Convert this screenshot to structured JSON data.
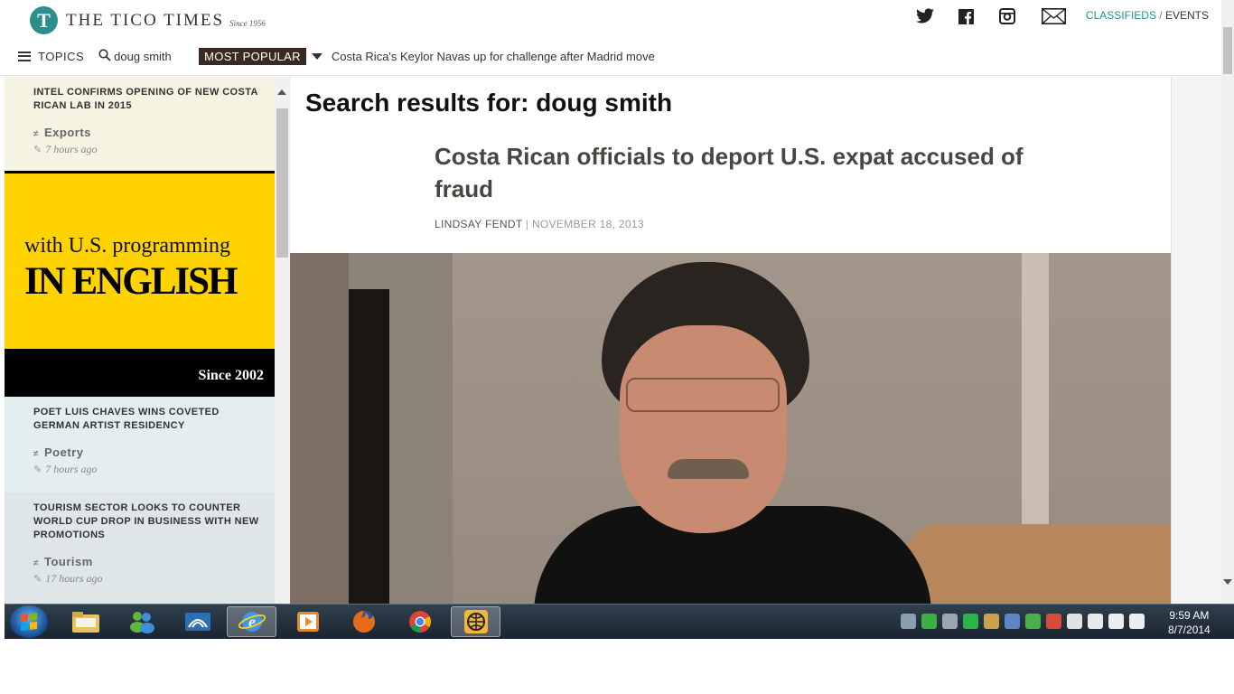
{
  "header": {
    "logo_letter": "T",
    "logo_name": "THE TICO TIMES",
    "logo_since": "Since 1956",
    "classifieds": "CLASSIFIEDS",
    "separator": "/",
    "events": "EVENTS"
  },
  "nav": {
    "topics": "TOPICS",
    "search_value": "doug smith",
    "most_popular": "MOST POPULAR",
    "ticker_headline": "Costa Rica's Keylor Navas up for challenge after Madrid move"
  },
  "sidebar": {
    "items": [
      {
        "title": "INTEL CONFIRMS OPENING OF NEW COSTA RICAN LAB IN 2015",
        "category": "Exports",
        "time": "7 hours ago"
      },
      {
        "title": "POET LUIS CHAVES WINS COVETED GERMAN ARTIST RESIDENCY",
        "category": "Poetry",
        "time": "7 hours ago"
      },
      {
        "title": "TOURISM SECTOR LOOKS TO COUNTER WORLD CUP DROP IN BUSINESS WITH NEW PROMOTIONS",
        "category": "Tourism",
        "time": "17 hours ago"
      }
    ],
    "ad": {
      "line1": "with U.S. programming",
      "line2": "IN ENGLISH",
      "since": "Since 2002"
    }
  },
  "main": {
    "search_heading": "Search results for: doug smith",
    "article_title": "Costa Rican officials to deport U.S. expat accused of fraud",
    "author": "LINDSAY FENDT",
    "byline_sep": "|",
    "date": "NOVEMBER 18, 2013"
  },
  "taskbar": {
    "time": "9:59 AM",
    "date": "8/7/2014"
  },
  "colors": {
    "brand_teal": "#2b8f8c",
    "popular_bg": "#3a2a20",
    "ad_yellow": "#ffd300"
  },
  "icons": [
    "twitter-icon",
    "facebook-icon",
    "instagram-icon",
    "mail-icon",
    "menu-icon",
    "search-icon",
    "dropdown-arrow-icon",
    "tag-icon",
    "edit-icon"
  ]
}
